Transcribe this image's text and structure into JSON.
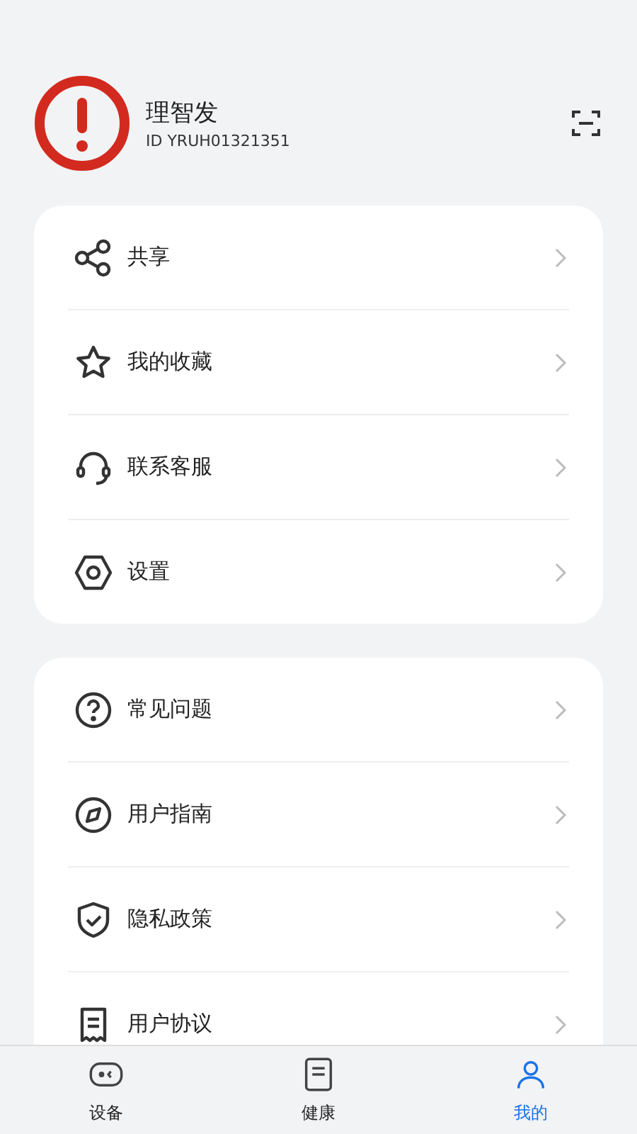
{
  "profile": {
    "name": "理智发",
    "id": "ID YRUH01321351"
  },
  "groups": [
    {
      "items": [
        {
          "label": "共享"
        },
        {
          "label": "我的收藏"
        },
        {
          "label": "联系客服"
        },
        {
          "label": "设置"
        }
      ]
    },
    {
      "items": [
        {
          "label": "常见问题"
        },
        {
          "label": "用户指南"
        },
        {
          "label": "隐私政策"
        },
        {
          "label": "用户协议"
        }
      ]
    }
  ],
  "tabs": [
    {
      "label": "设备",
      "selected": false
    },
    {
      "label": "健康",
      "selected": false
    },
    {
      "label": "我的",
      "selected": true
    }
  ]
}
